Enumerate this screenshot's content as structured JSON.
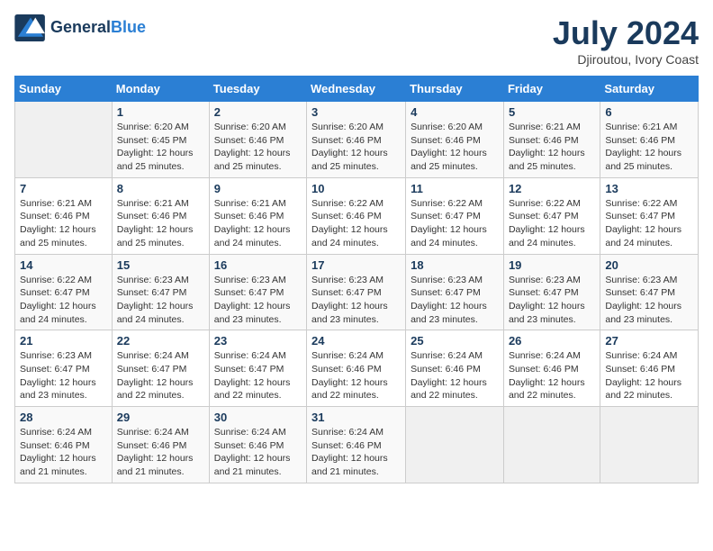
{
  "header": {
    "logo_line1": "General",
    "logo_line2": "Blue",
    "month": "July 2024",
    "location": "Djiroutou, Ivory Coast"
  },
  "weekdays": [
    "Sunday",
    "Monday",
    "Tuesday",
    "Wednesday",
    "Thursday",
    "Friday",
    "Saturday"
  ],
  "weeks": [
    [
      {
        "day": "",
        "info": ""
      },
      {
        "day": "1",
        "info": "Sunrise: 6:20 AM\nSunset: 6:45 PM\nDaylight: 12 hours\nand 25 minutes."
      },
      {
        "day": "2",
        "info": "Sunrise: 6:20 AM\nSunset: 6:46 PM\nDaylight: 12 hours\nand 25 minutes."
      },
      {
        "day": "3",
        "info": "Sunrise: 6:20 AM\nSunset: 6:46 PM\nDaylight: 12 hours\nand 25 minutes."
      },
      {
        "day": "4",
        "info": "Sunrise: 6:20 AM\nSunset: 6:46 PM\nDaylight: 12 hours\nand 25 minutes."
      },
      {
        "day": "5",
        "info": "Sunrise: 6:21 AM\nSunset: 6:46 PM\nDaylight: 12 hours\nand 25 minutes."
      },
      {
        "day": "6",
        "info": "Sunrise: 6:21 AM\nSunset: 6:46 PM\nDaylight: 12 hours\nand 25 minutes."
      }
    ],
    [
      {
        "day": "7",
        "info": "Sunrise: 6:21 AM\nSunset: 6:46 PM\nDaylight: 12 hours\nand 25 minutes."
      },
      {
        "day": "8",
        "info": "Sunrise: 6:21 AM\nSunset: 6:46 PM\nDaylight: 12 hours\nand 25 minutes."
      },
      {
        "day": "9",
        "info": "Sunrise: 6:21 AM\nSunset: 6:46 PM\nDaylight: 12 hours\nand 24 minutes."
      },
      {
        "day": "10",
        "info": "Sunrise: 6:22 AM\nSunset: 6:46 PM\nDaylight: 12 hours\nand 24 minutes."
      },
      {
        "day": "11",
        "info": "Sunrise: 6:22 AM\nSunset: 6:47 PM\nDaylight: 12 hours\nand 24 minutes."
      },
      {
        "day": "12",
        "info": "Sunrise: 6:22 AM\nSunset: 6:47 PM\nDaylight: 12 hours\nand 24 minutes."
      },
      {
        "day": "13",
        "info": "Sunrise: 6:22 AM\nSunset: 6:47 PM\nDaylight: 12 hours\nand 24 minutes."
      }
    ],
    [
      {
        "day": "14",
        "info": "Sunrise: 6:22 AM\nSunset: 6:47 PM\nDaylight: 12 hours\nand 24 minutes."
      },
      {
        "day": "15",
        "info": "Sunrise: 6:23 AM\nSunset: 6:47 PM\nDaylight: 12 hours\nand 24 minutes."
      },
      {
        "day": "16",
        "info": "Sunrise: 6:23 AM\nSunset: 6:47 PM\nDaylight: 12 hours\nand 23 minutes."
      },
      {
        "day": "17",
        "info": "Sunrise: 6:23 AM\nSunset: 6:47 PM\nDaylight: 12 hours\nand 23 minutes."
      },
      {
        "day": "18",
        "info": "Sunrise: 6:23 AM\nSunset: 6:47 PM\nDaylight: 12 hours\nand 23 minutes."
      },
      {
        "day": "19",
        "info": "Sunrise: 6:23 AM\nSunset: 6:47 PM\nDaylight: 12 hours\nand 23 minutes."
      },
      {
        "day": "20",
        "info": "Sunrise: 6:23 AM\nSunset: 6:47 PM\nDaylight: 12 hours\nand 23 minutes."
      }
    ],
    [
      {
        "day": "21",
        "info": "Sunrise: 6:23 AM\nSunset: 6:47 PM\nDaylight: 12 hours\nand 23 minutes."
      },
      {
        "day": "22",
        "info": "Sunrise: 6:24 AM\nSunset: 6:47 PM\nDaylight: 12 hours\nand 22 minutes."
      },
      {
        "day": "23",
        "info": "Sunrise: 6:24 AM\nSunset: 6:47 PM\nDaylight: 12 hours\nand 22 minutes."
      },
      {
        "day": "24",
        "info": "Sunrise: 6:24 AM\nSunset: 6:46 PM\nDaylight: 12 hours\nand 22 minutes."
      },
      {
        "day": "25",
        "info": "Sunrise: 6:24 AM\nSunset: 6:46 PM\nDaylight: 12 hours\nand 22 minutes."
      },
      {
        "day": "26",
        "info": "Sunrise: 6:24 AM\nSunset: 6:46 PM\nDaylight: 12 hours\nand 22 minutes."
      },
      {
        "day": "27",
        "info": "Sunrise: 6:24 AM\nSunset: 6:46 PM\nDaylight: 12 hours\nand 22 minutes."
      }
    ],
    [
      {
        "day": "28",
        "info": "Sunrise: 6:24 AM\nSunset: 6:46 PM\nDaylight: 12 hours\nand 21 minutes."
      },
      {
        "day": "29",
        "info": "Sunrise: 6:24 AM\nSunset: 6:46 PM\nDaylight: 12 hours\nand 21 minutes."
      },
      {
        "day": "30",
        "info": "Sunrise: 6:24 AM\nSunset: 6:46 PM\nDaylight: 12 hours\nand 21 minutes."
      },
      {
        "day": "31",
        "info": "Sunrise: 6:24 AM\nSunset: 6:46 PM\nDaylight: 12 hours\nand 21 minutes."
      },
      {
        "day": "",
        "info": ""
      },
      {
        "day": "",
        "info": ""
      },
      {
        "day": "",
        "info": ""
      }
    ]
  ]
}
